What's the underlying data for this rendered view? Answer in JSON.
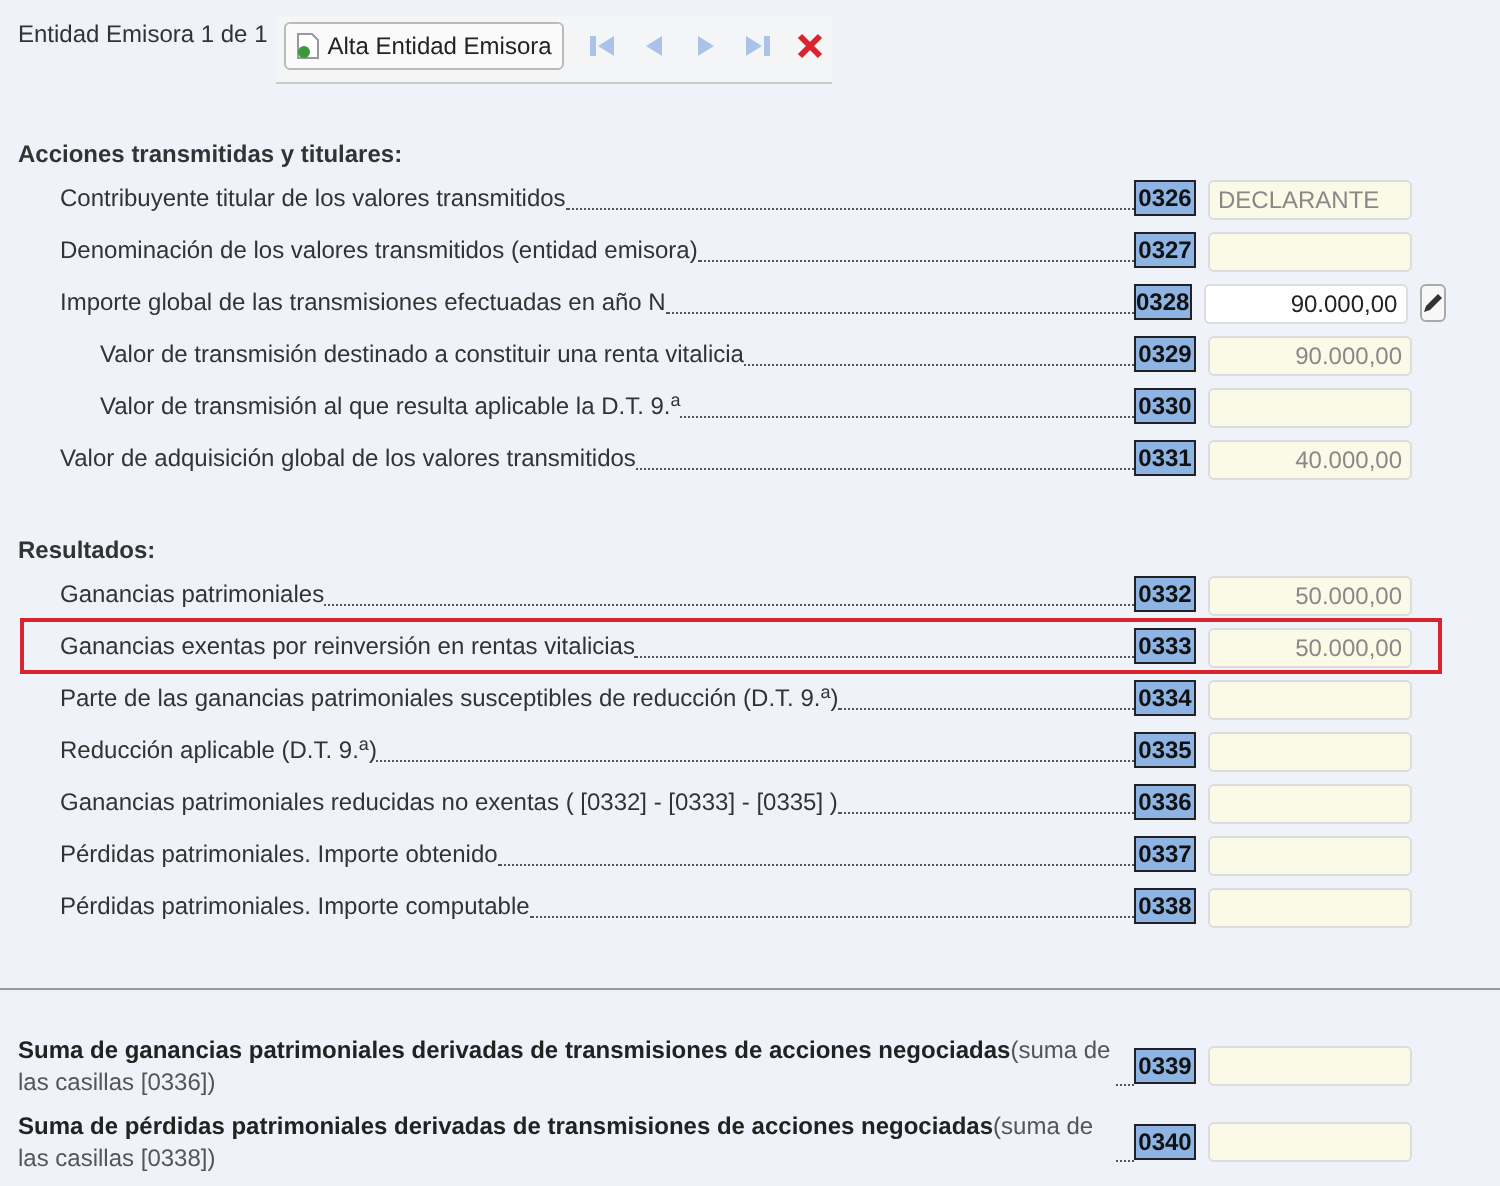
{
  "header": {
    "counter": "Entidad Emisora 1 de 1",
    "add_button": "Alta Entidad Emisora"
  },
  "sections": [
    {
      "title": "Acciones transmitidas y titulares:",
      "rows": [
        {
          "label": "Contribuyente titular de los valores transmitidos",
          "indent": false,
          "code": "0326",
          "value": "DECLARANTE",
          "kind": "text",
          "editable": false,
          "edit_button": false,
          "highlighted": false
        },
        {
          "label": "Denominación de los valores transmitidos (entidad emisora)",
          "indent": false,
          "code": "0327",
          "kind": "text",
          "editable": false,
          "edit_button": false,
          "highlighted": false
        },
        {
          "label": "Importe global de las transmisiones efectuadas en año N",
          "indent": false,
          "code": "0328",
          "value": "90.000,00",
          "kind": "amount",
          "editable": true,
          "edit_button": true,
          "highlighted": false
        },
        {
          "label": "Valor de transmisión destinado a constituir una renta vitalicia",
          "indent": true,
          "code": "0329",
          "value": "90.000,00",
          "kind": "amount",
          "editable": false,
          "edit_button": false,
          "highlighted": false
        },
        {
          "label": "Valor de transmisión al que resulta aplicable la D.T. 9.$^{a}$",
          "indent": true,
          "code": "0330",
          "kind": "amount",
          "editable": false,
          "edit_button": false,
          "highlighted": false
        },
        {
          "label": "Valor de adquisición global de los valores transmitidos",
          "indent": false,
          "code": "0331",
          "value": "40.000,00",
          "kind": "amount",
          "editable": false,
          "edit_button": false,
          "highlighted": false
        }
      ]
    },
    {
      "title": "Resultados:",
      "rows": [
        {
          "label": "Ganancias patrimoniales",
          "indent": false,
          "code": "0332",
          "value": "50.000,00",
          "kind": "amount",
          "editable": false,
          "edit_button": false,
          "highlighted": false
        },
        {
          "label": "Ganancias exentas por reinversión en rentas vitalicias",
          "indent": false,
          "code": "0333",
          "value": "50.000,00",
          "kind": "amount",
          "editable": false,
          "edit_button": false,
          "highlighted": true
        },
        {
          "label": "Parte de las ganancias patrimoniales susceptibles de reducción (D.T. 9.$^{a}$)",
          "indent": false,
          "code": "0334",
          "kind": "amount",
          "editable": false,
          "edit_button": false,
          "highlighted": false
        },
        {
          "label": "Reducción aplicable (D.T. 9.$^{a}$)",
          "indent": false,
          "code": "0335",
          "kind": "amount",
          "editable": false,
          "edit_button": false,
          "highlighted": false
        },
        {
          "label": "Ganancias patrimoniales reducidas no exentas ( [0332] - [0333] - [0335] )",
          "indent": false,
          "code": "0336",
          "kind": "amount",
          "editable": false,
          "edit_button": false,
          "highlighted": false
        },
        {
          "label": "Pérdidas patrimoniales. Importe obtenido",
          "indent": false,
          "code": "0337",
          "kind": "amount",
          "editable": false,
          "edit_button": false,
          "highlighted": false
        },
        {
          "label": "Pérdidas patrimoniales. Importe computable",
          "indent": false,
          "code": "0338",
          "kind": "amount",
          "editable": false,
          "edit_button": false,
          "highlighted": false
        }
      ]
    }
  ],
  "totals": [
    {
      "label": "**Suma de ganancias patrimoniales derivadas de transmisiones de acciones negociadas**(suma de las casillas [0336])",
      "code": "0339"
    },
    {
      "label": "**Suma de pérdidas patrimoniales derivadas de transmisiones de acciones negociadas**(suma de las casillas [0338])",
      "code": "0340"
    }
  ]
}
